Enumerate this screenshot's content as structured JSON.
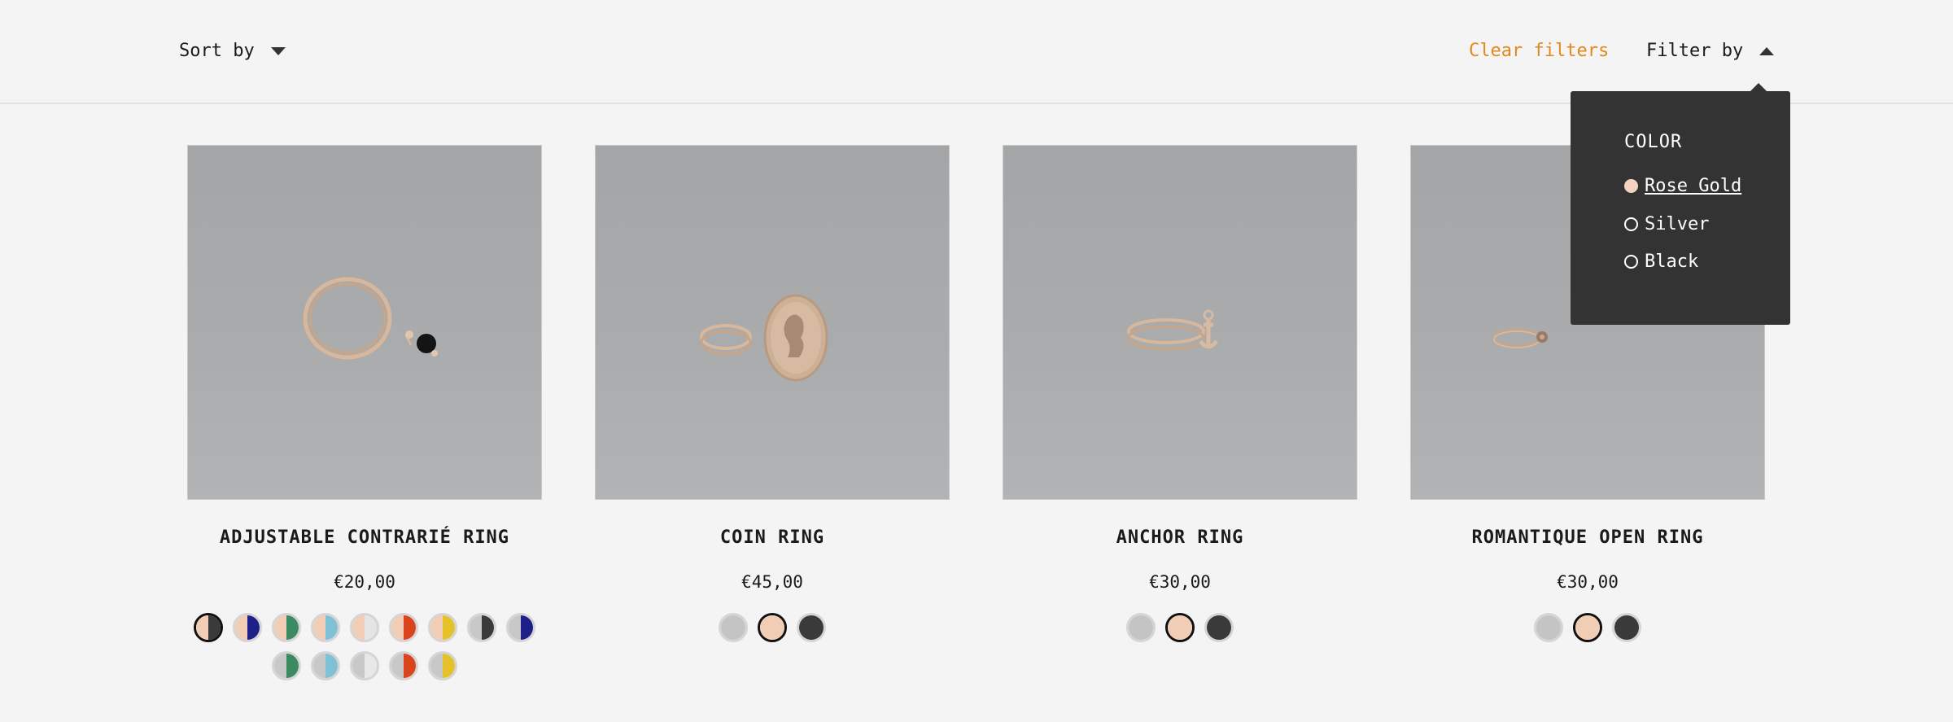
{
  "toolbar": {
    "sort_label": "Sort by",
    "clear_label": "Clear filters",
    "filter_label": "Filter by"
  },
  "filter_menu": {
    "title": "COLOR",
    "options": [
      {
        "label": "Rose Gold",
        "selected": true,
        "color": "#f3d2bf"
      },
      {
        "label": "Silver",
        "selected": false
      },
      {
        "label": "Black",
        "selected": false
      }
    ]
  },
  "colors": {
    "accent": "#e0891c",
    "rose_gold": "#f1cdb6",
    "silver": "#c4c4c4",
    "black": "#3a3a3a",
    "navy": "#1f1f8a",
    "green": "#3a8a62",
    "light_blue": "#7fc2d6",
    "red": "#d9441d",
    "yellow": "#e6c22a"
  },
  "products": [
    {
      "name": "ADJUSTABLE CONTRARIÉ RING",
      "price": "€20,00",
      "swatches": [
        {
          "left": "#f1cdb6",
          "right": "#3a3a3a",
          "selected": true
        },
        {
          "left": "#f1cdb6",
          "right": "#1f1f8a",
          "selected": false
        },
        {
          "left": "#f1cdb6",
          "right": "#3a8a62",
          "selected": false
        },
        {
          "left": "#f1cdb6",
          "right": "#7fc2d6",
          "selected": false
        },
        {
          "left": "#f1cdb6",
          "right": "#e4e4e4",
          "selected": false
        },
        {
          "left": "#f1cdb6",
          "right": "#d9441d",
          "selected": false
        },
        {
          "left": "#f1cdb6",
          "right": "#e6c22a",
          "selected": false
        },
        {
          "left": "#c8c8c8",
          "right": "#3a3a3a",
          "selected": false
        },
        {
          "left": "#c8c8c8",
          "right": "#1f1f8a",
          "selected": false
        },
        {
          "left": "#c8c8c8",
          "right": "#3a8a62",
          "selected": false
        },
        {
          "left": "#c8c8c8",
          "right": "#7fc2d6",
          "selected": false
        },
        {
          "left": "#c8c8c8",
          "right": "#e8e8e8",
          "selected": false
        },
        {
          "left": "#c8c8c8",
          "right": "#d9441d",
          "selected": false
        },
        {
          "left": "#c8c8c8",
          "right": "#e6c22a",
          "selected": false
        }
      ]
    },
    {
      "name": "COIN RING",
      "price": "€45,00",
      "swatches": [
        {
          "left": "#c4c4c4",
          "right": "#c4c4c4",
          "selected": false
        },
        {
          "left": "#f1cdb6",
          "right": "#f1cdb6",
          "selected": true
        },
        {
          "left": "#3a3a3a",
          "right": "#3a3a3a",
          "selected": false
        }
      ]
    },
    {
      "name": "ANCHOR RING",
      "price": "€30,00",
      "swatches": [
        {
          "left": "#c4c4c4",
          "right": "#c4c4c4",
          "selected": false
        },
        {
          "left": "#f1cdb6",
          "right": "#f1cdb6",
          "selected": true
        },
        {
          "left": "#3a3a3a",
          "right": "#3a3a3a",
          "selected": false
        }
      ]
    },
    {
      "name": "ROMANTIQUE OPEN RING",
      "price": "€30,00",
      "swatches": [
        {
          "left": "#c4c4c4",
          "right": "#c4c4c4",
          "selected": false
        },
        {
          "left": "#f1cdb6",
          "right": "#f1cdb6",
          "selected": true
        },
        {
          "left": "#3a3a3a",
          "right": "#3a3a3a",
          "selected": false
        }
      ]
    }
  ]
}
